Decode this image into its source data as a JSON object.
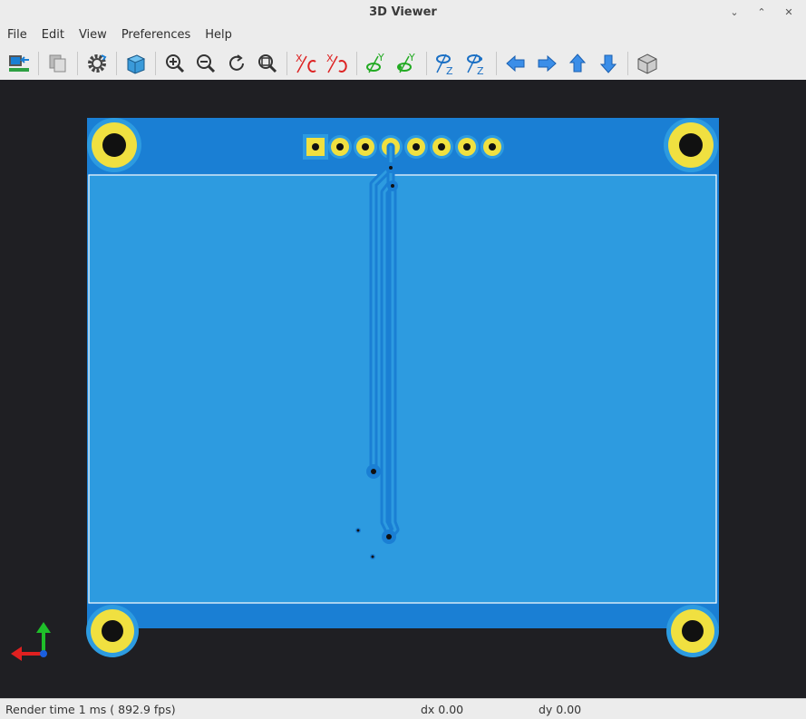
{
  "window": {
    "title": "3D Viewer"
  },
  "window_controls": {
    "minimize": "⌄",
    "restore": "⌃",
    "close": "✕"
  },
  "menu": [
    "File",
    "Edit",
    "View",
    "Preferences",
    "Help"
  ],
  "toolbar": {
    "axis_labels": {
      "x": "X",
      "y": "Y",
      "z": "Z"
    }
  },
  "status": {
    "render_time": "Render time 1 ms ( 892.9 fps)",
    "dx": "dx 0.00",
    "dy": "dy 0.00"
  },
  "colors": {
    "board": "#2d9be0",
    "board_edge": "#1a7fd4",
    "copper": "#1a7fd4",
    "pad": "#f0e040",
    "background": "#1e1e22"
  }
}
